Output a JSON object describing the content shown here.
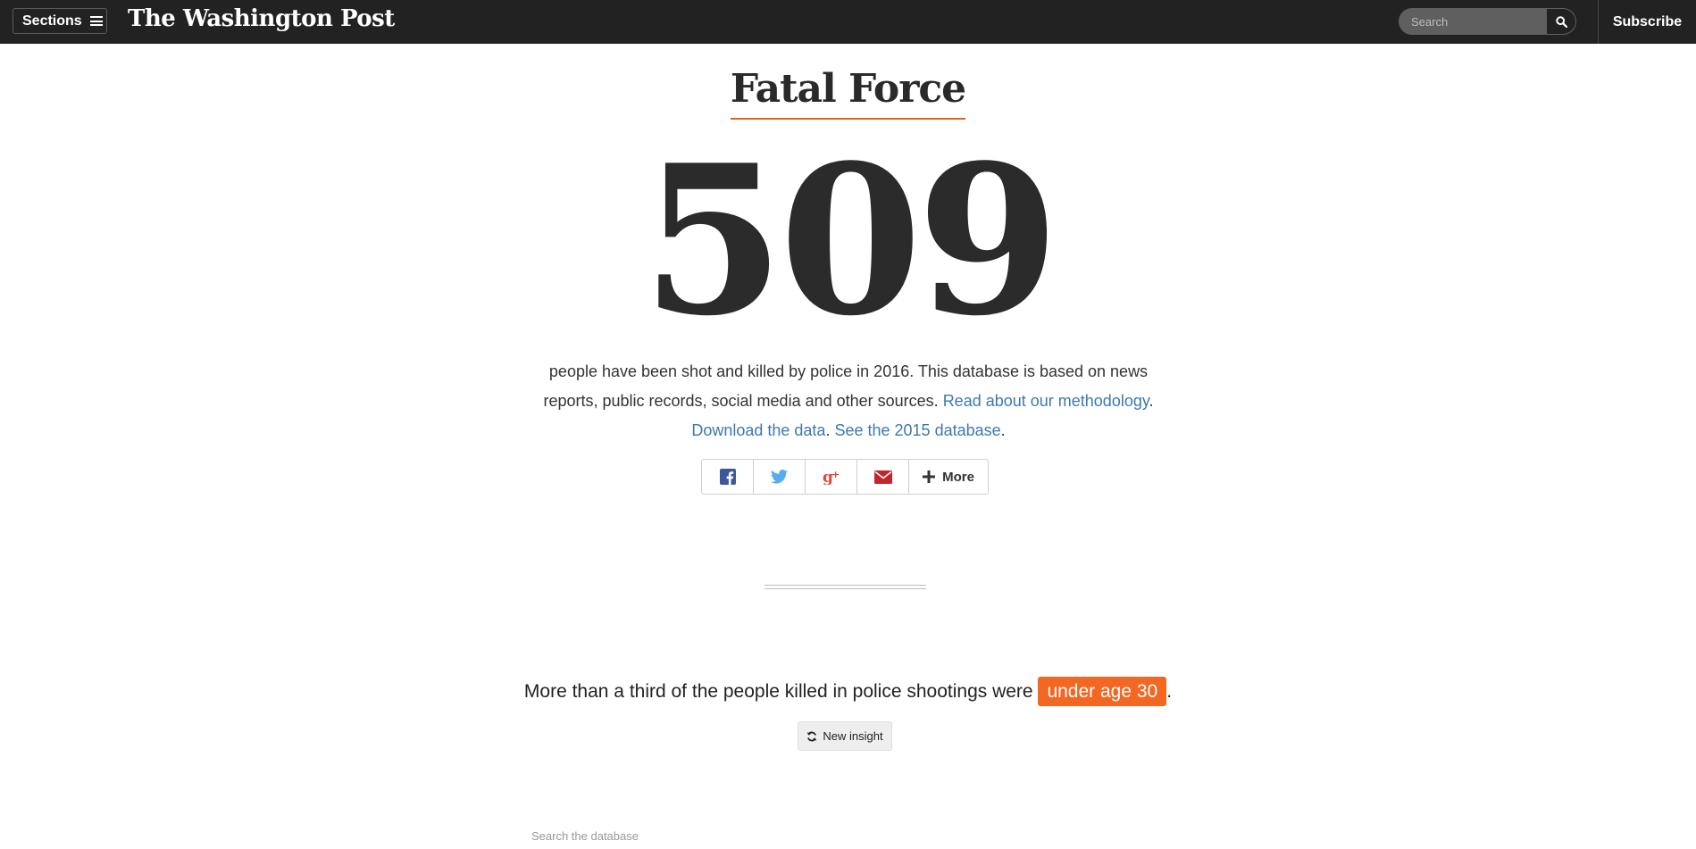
{
  "nav": {
    "sections_label": "Sections",
    "logo_text": "The Washington Post",
    "search_placeholder": "Search",
    "subscribe_label": "Subscribe"
  },
  "page": {
    "title": "Fatal Force",
    "count": "509",
    "intro_text": "people have been shot and killed by police in 2016. This database is based on news reports, public records, social media and other sources.",
    "methodology_link": "Read about our methodology",
    "download_link": "Download the data",
    "database_2015_link": "See the 2015 database",
    "period": "."
  },
  "share": {
    "more_label": "More",
    "icons": [
      "facebook-icon",
      "twitter-icon",
      "google-plus-icon",
      "email-icon",
      "plus-icon"
    ]
  },
  "insight": {
    "text": "More than a third of the people killed in police shootings were",
    "highlight": "under age 30",
    "end": ".",
    "new_insight_label": "New insight"
  },
  "database": {
    "search_placeholder": "Search the database"
  },
  "colors": {
    "nav_bg": "#222222",
    "accent_orange": "#f26722",
    "link_blue": "#3e79ad",
    "facebook": "#3b5998",
    "twitter": "#55acee",
    "google_plus": "#dd4b39",
    "email": "#c0262c"
  }
}
